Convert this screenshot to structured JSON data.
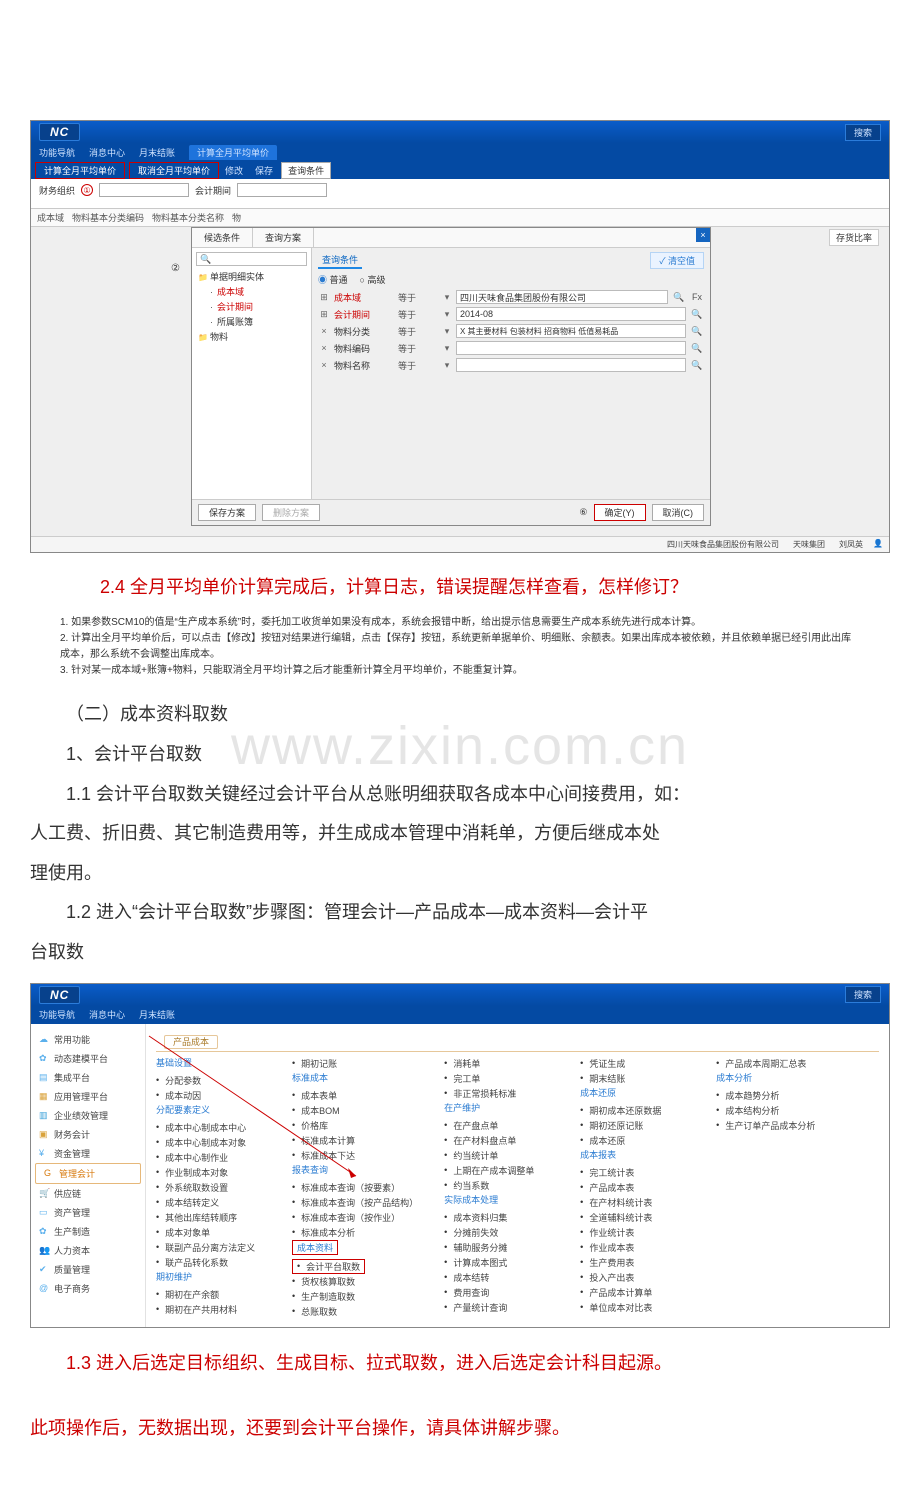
{
  "doc": {
    "heading24": "2.4 全月平均单价计算完成后，计算日志，错误提醒怎样查看，怎样修订？",
    "notes": {
      "n1": "1. 如果参数SCM10的值是“生产成本系统”时，委托加工收货单如果没有成本，系统会报错中断，给出提示信息需要生产成本系统先进行成本计算。",
      "n2": "2. 计算出全月平均单价后，可以点击【修改】按钮对结果进行编辑，点击【保存】按钮，系统更新单据单价、明细账、余额表。如果出库成本被依赖，并且依赖单据已经引用此出库成本，那么系统不会调整出库成本。",
      "n3": "3. 针对某一成本域+账簿+物料，只能取消全月平均计算之后才能重新计算全月平均单价，不能重复计算。"
    },
    "h_sec2": "（二）成本资料取数",
    "h_sec2_1": "1、会计平台取数",
    "p11_a": "1.1 会计平台取数关键经过会计平台从总账明细获取各成本中心间接费用，如：",
    "p11_b": "人工费、折旧费、其它制造费用等，并生成成本管理中消耗单，方便后继成本处",
    "p11_c": "理使用。",
    "p12_a": "1.2 进入“会计平台取数”步骤图：管理会计—产品成本—成本资料—会计平",
    "p12_b": "台取数",
    "p13_a": "1.3 进入后选定目标组织、生成目标、拉式取数，进入后选定会计科目起源。",
    "p13_b": "此项操作后，无数据出现，还要到会计平台操作，请具体讲解步骤。",
    "watermark": "www.zixin.com.cn"
  },
  "ss1": {
    "logo": "NC",
    "search_right": "搜索",
    "menubar": {
      "m1": "功能导航",
      "m2": "消息中心",
      "m3": "月末结账",
      "tab_active": "计算全月平均单价"
    },
    "toolbar": {
      "b1": "计算全月平均单价",
      "b2": "取消全月平均单价",
      "b3": "修改",
      "b4": "保存",
      "qc": "查询条件"
    },
    "left": {
      "l1": "财务组织",
      "l2": "会计期间",
      "c1": "成本域",
      "c2": "物料基本分类编码",
      "c3": "物料基本分类名称",
      "c4": "物"
    },
    "modal": {
      "tab1": "候选条件",
      "tab2": "查询方案",
      "cond_title": "查询条件",
      "radio1": "普通",
      "radio2": "高级",
      "qsz": "✓ 清空值",
      "tree": {
        "root": "单据明细实体",
        "t1": "成本域",
        "t2": "会计期间",
        "t3": "所属账簿",
        "t4": "物料"
      },
      "rows": {
        "r1": {
          "label": "成本域",
          "op": "等于",
          "val": "四川天味食品集团股份有限公司"
        },
        "r2": {
          "label": "会计期间",
          "op": "等于",
          "val": "2014-08"
        },
        "r3": {
          "label": "物料分类",
          "op": "等于",
          "val": "X 其主要材料 包装材料 招商物料 低值易耗品"
        },
        "r4": {
          "label": "物料编码",
          "op": "等于",
          "val": ""
        },
        "r5": {
          "label": "物料名称",
          "op": "等于",
          "val": ""
        }
      },
      "foot": {
        "save": "保存方案",
        "del": "删除方案",
        "ok": "确定(Y)",
        "cancel": "取消(C)"
      }
    },
    "right_label": "存货比率",
    "footer": {
      "f1": "四川天味食品集团股份有限公司",
      "f2": "天味集团",
      "f3": "刘凤英"
    }
  },
  "ss2": {
    "logo": "NC",
    "search_right": "搜索",
    "menubar": {
      "m1": "功能导航",
      "m2": "消息中心",
      "m3": "月末结账"
    },
    "crumb": "产品成本",
    "side": {
      "s1": "常用功能",
      "s2": "动态建模平台",
      "s3": "集成平台",
      "s4": "应用管理平台",
      "s5": "企业绩效管理",
      "s6": "财务会计",
      "s7": "资金管理",
      "s8": "管理会计",
      "s9": "供应链",
      "s10": "资产管理",
      "s11": "生产制造",
      "s12": "人力资本",
      "s13": "质量管理",
      "s14": "电子商务"
    },
    "cols": {
      "c1": {
        "h1": "基础设置",
        "i1": "分配参数",
        "i2": "成本动因",
        "h2": "分配要素定义",
        "i3": "成本中心制成本中心",
        "i4": "成本中心制成本对象",
        "i5": "成本中心制作业",
        "i6": "作业制成本对象",
        "i7": "外系统取数设置",
        "i8": "成本结转定义",
        "i9": "其他出库结转顺序",
        "i10": "成本对象单",
        "i11": "联副产品分离方法定义",
        "i12": "联产品转化系数",
        "h3": "期初维护",
        "i13": "期初在产余额",
        "i14": "期初在产共用材料"
      },
      "c2": {
        "i1": "期初记账",
        "h1": "标准成本",
        "i2": "成本表单",
        "i3": "成本BOM",
        "i4": "价格库",
        "i5": "标准成本计算",
        "i6": "标准成本下达",
        "h2": "报表查询",
        "i7": "标准成本查询（按要素）",
        "i8": "标准成本查询（按产品结构）",
        "i9": "标准成本查询（按作业）",
        "i10": "标准成本分析",
        "h3": "成本资料",
        "i11": "会计平台取数",
        "i12": "货权核算取数",
        "i13": "生产制造取数",
        "i14": "总账取数"
      },
      "c3": {
        "i1": "消耗单",
        "i2": "完工单",
        "i3": "非正常损耗标准",
        "h1": "在产维护",
        "i4": "在产盘点单",
        "i5": "在产材料盘点单",
        "i6": "约当统计单",
        "i7": "上期在产成本调整单",
        "i8": "约当系数",
        "h2": "实际成本处理",
        "i9": "成本资料归集",
        "i10": "分摊前失效",
        "i11": "辅助服务分摊",
        "i12": "计算成本图式",
        "i13": "成本结转",
        "i14": "费用查询",
        "i15": "产量统计查询"
      },
      "c4": {
        "i1": "凭证生成",
        "i2": "期末结账",
        "h1": "成本还原",
        "i3": "期初成本还原数据",
        "i4": "期初还原记账",
        "i5": "成本还原",
        "h2": "成本报表",
        "i6": "完工统计表",
        "i7": "产品成本表",
        "i8": "在产材料统计表",
        "i9": "全道辅料统计表",
        "i10": "作业统计表",
        "i11": "作业成本表",
        "i12": "生产费用表",
        "i13": "投入产出表",
        "i14": "产品成本计算单",
        "i15": "单位成本对比表"
      },
      "c5": {
        "i1": "产品成本周期汇总表",
        "h1": "成本分析",
        "i2": "成本趋势分析",
        "i3": "成本结构分析",
        "i4": "生产订单产品成本分析"
      }
    }
  }
}
